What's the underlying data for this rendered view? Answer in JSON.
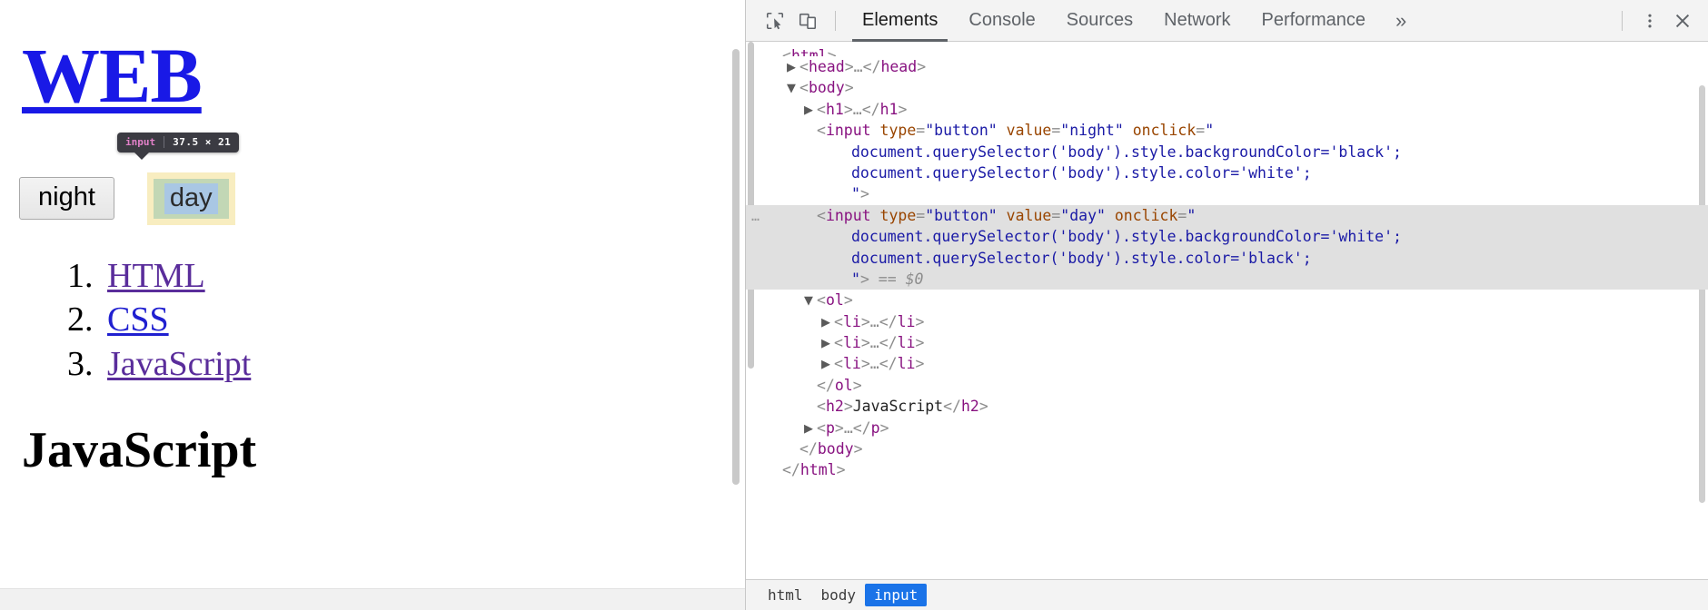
{
  "page": {
    "title": "WEB",
    "buttons": {
      "night": "night",
      "day": "day"
    },
    "inspect_tooltip": {
      "tag": "input",
      "dimensions": "37.5 × 21"
    },
    "list": [
      {
        "label": "HTML",
        "state": "visited"
      },
      {
        "label": "CSS",
        "state": "unvisited"
      },
      {
        "label": "JavaScript",
        "state": "visited"
      }
    ],
    "subheading": "JavaScript",
    "colors": {
      "title": "#1919e6",
      "visited_link": "#5a2d9b",
      "unvisited_link": "#2020d0",
      "highlight_margin": "#f8edc0",
      "highlight_padding": "#c2d7b5",
      "highlight_content": "#a9c7e4"
    }
  },
  "devtools": {
    "toolbar": {
      "inspect_icon": "inspect-element-icon",
      "device_icon": "device-toolbar-icon",
      "more_tabs": "»",
      "kebab": "⋮",
      "close": "✕"
    },
    "tabs": [
      {
        "label": "Elements",
        "active": true
      },
      {
        "label": "Console",
        "active": false
      },
      {
        "label": "Sources",
        "active": false
      },
      {
        "label": "Network",
        "active": false
      },
      {
        "label": "Performance",
        "active": false
      }
    ],
    "tree": {
      "rows": [
        {
          "id": "r-html-open",
          "indent": 0,
          "twisty": "",
          "segments": [
            {
              "t": "brk",
              "v": "<"
            },
            {
              "t": "tag",
              "v": "html"
            },
            {
              "t": "brk",
              "v": ">"
            }
          ],
          "clipped": true
        },
        {
          "id": "r-head",
          "indent": 1,
          "twisty": "▶",
          "segments": [
            {
              "t": "brk",
              "v": "<"
            },
            {
              "t": "tag",
              "v": "head"
            },
            {
              "t": "brk",
              "v": ">"
            },
            {
              "t": "ellip",
              "v": "…"
            },
            {
              "t": "brk",
              "v": "</"
            },
            {
              "t": "tag",
              "v": "head"
            },
            {
              "t": "brk",
              "v": ">"
            }
          ]
        },
        {
          "id": "r-body-open",
          "indent": 1,
          "twisty": "▼",
          "segments": [
            {
              "t": "brk",
              "v": "<"
            },
            {
              "t": "tag",
              "v": "body"
            },
            {
              "t": "brk",
              "v": ">"
            }
          ]
        },
        {
          "id": "r-h1",
          "indent": 2,
          "twisty": "▶",
          "segments": [
            {
              "t": "brk",
              "v": "<"
            },
            {
              "t": "tag",
              "v": "h1"
            },
            {
              "t": "brk",
              "v": ">"
            },
            {
              "t": "ellip",
              "v": "…"
            },
            {
              "t": "brk",
              "v": "</"
            },
            {
              "t": "tag",
              "v": "h1"
            },
            {
              "t": "brk",
              "v": ">"
            }
          ]
        },
        {
          "id": "r-input-night-1",
          "indent": 2,
          "twisty": "",
          "segments": [
            {
              "t": "brk",
              "v": "<"
            },
            {
              "t": "tag",
              "v": "input"
            },
            {
              "t": "txt",
              "v": " "
            },
            {
              "t": "attr",
              "v": "type"
            },
            {
              "t": "brk",
              "v": "="
            },
            {
              "t": "val",
              "v": "\"button\""
            },
            {
              "t": "txt",
              "v": " "
            },
            {
              "t": "attr",
              "v": "value"
            },
            {
              "t": "brk",
              "v": "="
            },
            {
              "t": "val",
              "v": "\"night\""
            },
            {
              "t": "txt",
              "v": " "
            },
            {
              "t": "attr",
              "v": "onclick"
            },
            {
              "t": "brk",
              "v": "="
            },
            {
              "t": "val",
              "v": "\""
            }
          ]
        },
        {
          "id": "r-input-night-2",
          "indent": 4,
          "twisty": "",
          "segments": [
            {
              "t": "code",
              "v": "document.querySelector('body').style.backgroundColor='black';"
            }
          ]
        },
        {
          "id": "r-input-night-3",
          "indent": 4,
          "twisty": "",
          "segments": [
            {
              "t": "code",
              "v": "document.querySelector('body').style.color='white';"
            }
          ]
        },
        {
          "id": "r-input-night-4",
          "indent": 4,
          "twisty": "",
          "segments": [
            {
              "t": "val",
              "v": "\""
            },
            {
              "t": "brk",
              "v": ">"
            }
          ]
        },
        {
          "id": "r-input-day-1",
          "indent": 2,
          "twisty": "",
          "selected": true,
          "dots": "…",
          "segments": [
            {
              "t": "brk",
              "v": "<"
            },
            {
              "t": "tag",
              "v": "input"
            },
            {
              "t": "txt",
              "v": " "
            },
            {
              "t": "attr",
              "v": "type"
            },
            {
              "t": "brk",
              "v": "="
            },
            {
              "t": "val",
              "v": "\"button\""
            },
            {
              "t": "txt",
              "v": " "
            },
            {
              "t": "attr",
              "v": "value"
            },
            {
              "t": "brk",
              "v": "="
            },
            {
              "t": "val",
              "v": "\"day\""
            },
            {
              "t": "txt",
              "v": " "
            },
            {
              "t": "attr",
              "v": "onclick"
            },
            {
              "t": "brk",
              "v": "="
            },
            {
              "t": "val",
              "v": "\""
            }
          ]
        },
        {
          "id": "r-input-day-2",
          "indent": 4,
          "twisty": "",
          "selected": true,
          "segments": [
            {
              "t": "code",
              "v": "document.querySelector('body').style.backgroundColor='white';"
            }
          ]
        },
        {
          "id": "r-input-day-3",
          "indent": 4,
          "twisty": "",
          "selected": true,
          "segments": [
            {
              "t": "code",
              "v": "document.querySelector('body').style.color='black';"
            }
          ]
        },
        {
          "id": "r-input-day-4",
          "indent": 4,
          "twisty": "",
          "selected": true,
          "segments": [
            {
              "t": "val",
              "v": "\""
            },
            {
              "t": "brk",
              "v": ">"
            },
            {
              "t": "dollar",
              "v": " == $0"
            }
          ]
        },
        {
          "id": "r-ol-open",
          "indent": 2,
          "twisty": "▼",
          "segments": [
            {
              "t": "brk",
              "v": "<"
            },
            {
              "t": "tag",
              "v": "ol"
            },
            {
              "t": "brk",
              "v": ">"
            }
          ]
        },
        {
          "id": "r-li-1",
          "indent": 3,
          "twisty": "▶",
          "segments": [
            {
              "t": "brk",
              "v": "<"
            },
            {
              "t": "tag",
              "v": "li"
            },
            {
              "t": "brk",
              "v": ">"
            },
            {
              "t": "ellip",
              "v": "…"
            },
            {
              "t": "brk",
              "v": "</"
            },
            {
              "t": "tag",
              "v": "li"
            },
            {
              "t": "brk",
              "v": ">"
            }
          ]
        },
        {
          "id": "r-li-2",
          "indent": 3,
          "twisty": "▶",
          "segments": [
            {
              "t": "brk",
              "v": "<"
            },
            {
              "t": "tag",
              "v": "li"
            },
            {
              "t": "brk",
              "v": ">"
            },
            {
              "t": "ellip",
              "v": "…"
            },
            {
              "t": "brk",
              "v": "</"
            },
            {
              "t": "tag",
              "v": "li"
            },
            {
              "t": "brk",
              "v": ">"
            }
          ]
        },
        {
          "id": "r-li-3",
          "indent": 3,
          "twisty": "▶",
          "segments": [
            {
              "t": "brk",
              "v": "<"
            },
            {
              "t": "tag",
              "v": "li"
            },
            {
              "t": "brk",
              "v": ">"
            },
            {
              "t": "ellip",
              "v": "…"
            },
            {
              "t": "brk",
              "v": "</"
            },
            {
              "t": "tag",
              "v": "li"
            },
            {
              "t": "brk",
              "v": ">"
            }
          ]
        },
        {
          "id": "r-ol-close",
          "indent": 2,
          "twisty": "",
          "segments": [
            {
              "t": "brk",
              "v": "</"
            },
            {
              "t": "tag",
              "v": "ol"
            },
            {
              "t": "brk",
              "v": ">"
            }
          ]
        },
        {
          "id": "r-h2",
          "indent": 2,
          "twisty": "",
          "segments": [
            {
              "t": "brk",
              "v": "<"
            },
            {
              "t": "tag",
              "v": "h2"
            },
            {
              "t": "brk",
              "v": ">"
            },
            {
              "t": "txt",
              "v": "JavaScript"
            },
            {
              "t": "brk",
              "v": "</"
            },
            {
              "t": "tag",
              "v": "h2"
            },
            {
              "t": "brk",
              "v": ">"
            }
          ]
        },
        {
          "id": "r-p",
          "indent": 2,
          "twisty": "▶",
          "segments": [
            {
              "t": "brk",
              "v": "<"
            },
            {
              "t": "tag",
              "v": "p"
            },
            {
              "t": "brk",
              "v": ">"
            },
            {
              "t": "ellip",
              "v": "…"
            },
            {
              "t": "brk",
              "v": "</"
            },
            {
              "t": "tag",
              "v": "p"
            },
            {
              "t": "brk",
              "v": ">"
            }
          ]
        },
        {
          "id": "r-body-close",
          "indent": 1,
          "twisty": "",
          "segments": [
            {
              "t": "brk",
              "v": "</"
            },
            {
              "t": "tag",
              "v": "body"
            },
            {
              "t": "brk",
              "v": ">"
            }
          ]
        },
        {
          "id": "r-html-close",
          "indent": 0,
          "twisty": "",
          "segments": [
            {
              "t": "brk",
              "v": "</"
            },
            {
              "t": "tag",
              "v": "html"
            },
            {
              "t": "brk",
              "v": ">"
            }
          ]
        }
      ]
    },
    "breadcrumb": [
      {
        "label": "html",
        "active": false
      },
      {
        "label": "body",
        "active": false
      },
      {
        "label": "input",
        "active": true
      }
    ]
  }
}
